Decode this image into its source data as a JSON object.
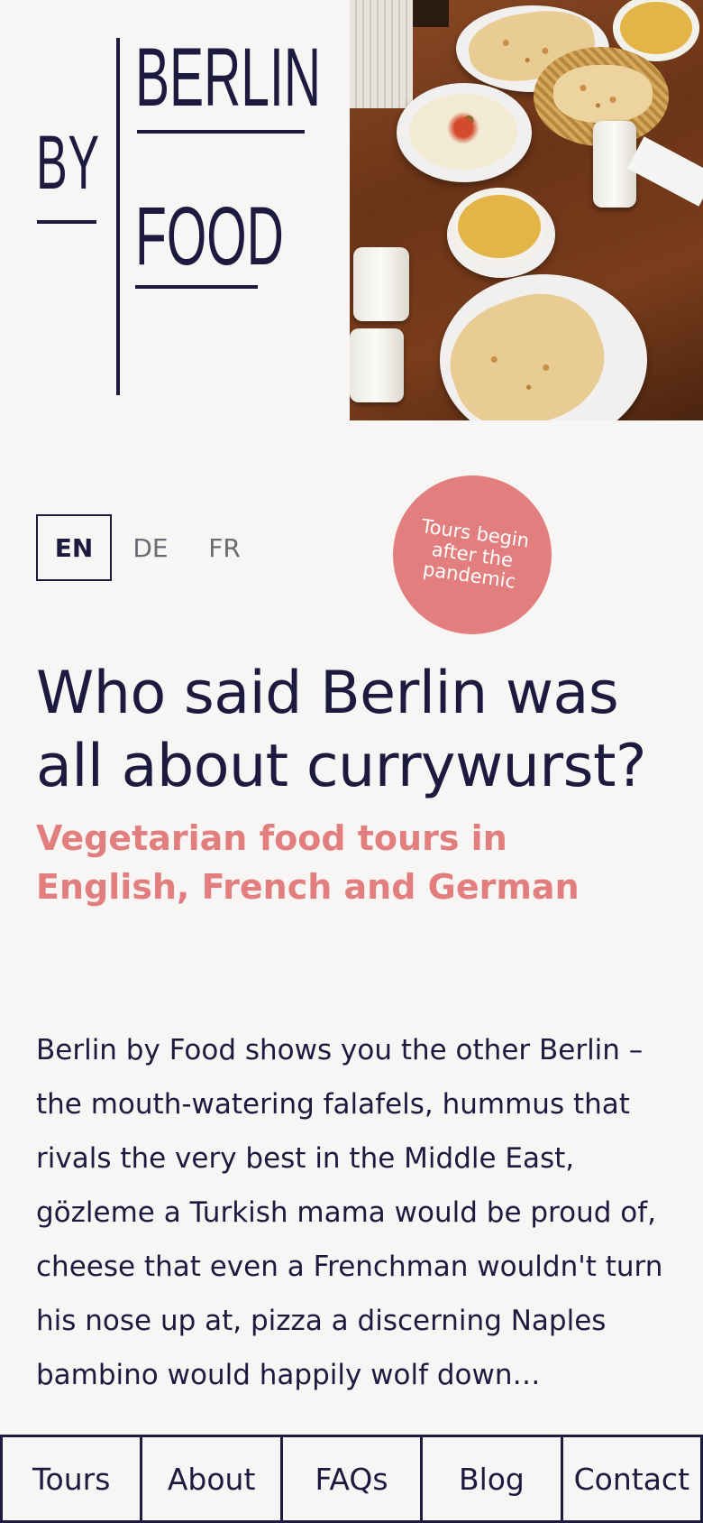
{
  "logo": {
    "by": "BY",
    "berlin": "BERLIN",
    "food": "FOOD"
  },
  "hero": {
    "icon": "food-photo-image"
  },
  "language": {
    "options": [
      "EN",
      "DE",
      "FR"
    ],
    "selected": "EN"
  },
  "badge": {
    "text": "Tours begin after the pandemic"
  },
  "headline": "Who said Berlin was all about currywurst?",
  "subheadline": "Vegetarian food tours in English, French and German",
  "intro": "Berlin by Food shows you the other Berlin – the mouth-watering falafels, hummus that rivals the very best in the Middle East, gözleme a Turkish mama would be proud of, cheese that even a Frenchman wouldn't turn his nose up at, pizza a discerning Naples bambino would happily wolf down…",
  "nav": {
    "items": [
      "Tours",
      "About",
      "FAQs",
      "Blog",
      "Contact"
    ]
  },
  "colors": {
    "navy": "#1d1a40",
    "coral": "#e27e7e",
    "background": "#f7f6f4"
  }
}
